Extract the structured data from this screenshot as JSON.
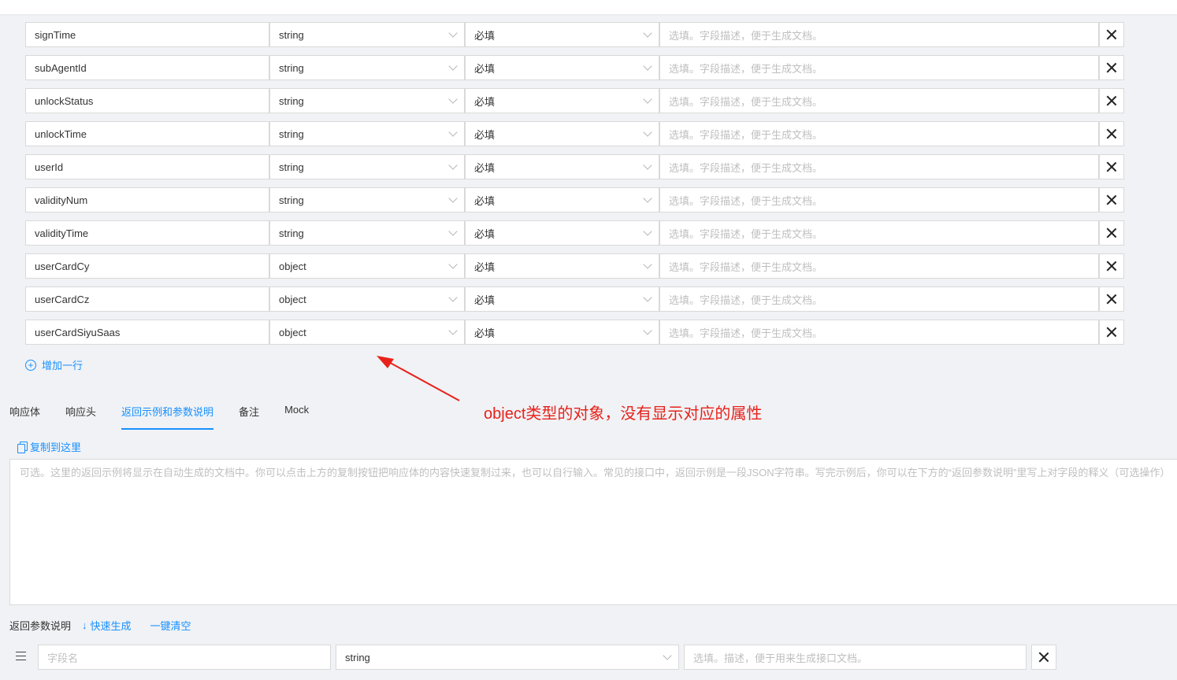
{
  "params": {
    "rows": [
      {
        "name": "signTime",
        "type": "string",
        "required": "必填",
        "desc_placeholder": "选填。字段描述，便于生成文档。"
      },
      {
        "name": "subAgentId",
        "type": "string",
        "required": "必填",
        "desc_placeholder": "选填。字段描述，便于生成文档。"
      },
      {
        "name": "unlockStatus",
        "type": "string",
        "required": "必填",
        "desc_placeholder": "选填。字段描述，便于生成文档。"
      },
      {
        "name": "unlockTime",
        "type": "string",
        "required": "必填",
        "desc_placeholder": "选填。字段描述，便于生成文档。"
      },
      {
        "name": "userId",
        "type": "string",
        "required": "必填",
        "desc_placeholder": "选填。字段描述，便于生成文档。"
      },
      {
        "name": "validityNum",
        "type": "string",
        "required": "必填",
        "desc_placeholder": "选填。字段描述，便于生成文档。"
      },
      {
        "name": "validityTime",
        "type": "string",
        "required": "必填",
        "desc_placeholder": "选填。字段描述，便于生成文档。"
      },
      {
        "name": "userCardCy",
        "type": "object",
        "required": "必填",
        "desc_placeholder": "选填。字段描述，便于生成文档。"
      },
      {
        "name": "userCardCz",
        "type": "object",
        "required": "必填",
        "desc_placeholder": "选填。字段描述，便于生成文档。"
      },
      {
        "name": "userCardSiyuSaas",
        "type": "object",
        "required": "必填",
        "desc_placeholder": "选填。字段描述，便于生成文档。"
      }
    ],
    "add_row_label": "增加一行"
  },
  "annotation": {
    "text": "object类型的对象，没有显示对应的属性",
    "color": "#e8221b"
  },
  "tabs": {
    "items": [
      {
        "label": "响应体"
      },
      {
        "label": "响应头"
      },
      {
        "label": "返回示例和参数说明"
      },
      {
        "label": "备注"
      },
      {
        "label": "Mock"
      }
    ],
    "active_index": 2
  },
  "example": {
    "copy_label": "复制到这里",
    "placeholder": "可选。这里的返回示例将显示在自动生成的文档中。你可以点击上方的复制按钮把响应体的内容快速复制过来，也可以自行输入。常见的接口中，返回示例是一段JSON字符串。写完示例后，你可以在下方的“返回参数说明”里写上对字段的释义（可选操作）"
  },
  "return_params": {
    "label": "返回参数说明",
    "quick_gen_label": "快速生成",
    "clear_label": "一键清空",
    "field_name_placeholder": "字段名",
    "field_type": "string",
    "field_desc_placeholder": "选填。描述，便于用来生成接口文档。"
  },
  "colors": {
    "accent": "#1890ff",
    "background": "#f0f2f5",
    "border": "#d9d9d9"
  }
}
